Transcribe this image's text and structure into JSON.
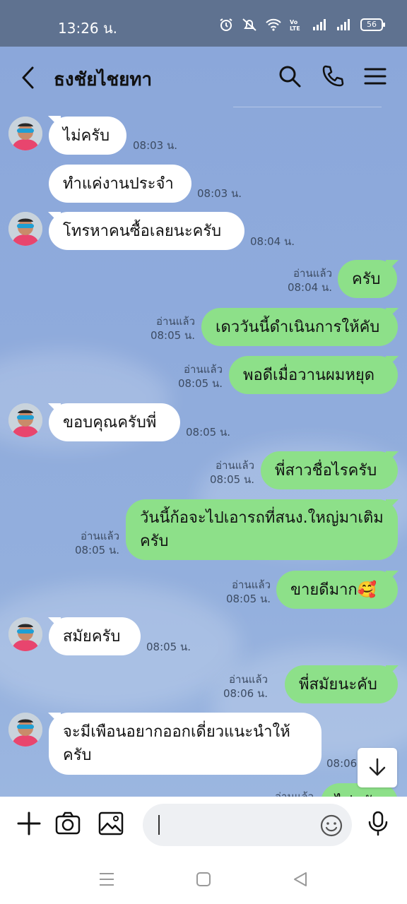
{
  "status_bar": {
    "time": "13:26 น.",
    "battery": "56"
  },
  "header": {
    "contact_name": "ธงชัยไชยทา"
  },
  "messages": [
    {
      "text": "ไม่ครับ",
      "time": "08:03 น."
    },
    {
      "text": "ทำแค่งานประจำ",
      "time": "08:03 น."
    },
    {
      "text": "โทรหาคนซื้อเลยนะครับ",
      "time": "08:04 น."
    },
    {
      "text": "ครับ",
      "read": "อ่านแล้ว",
      "time": "08:04 น."
    },
    {
      "text": "เดววันนี้ดำเนินการให้คับ",
      "read": "อ่านแล้ว",
      "time": "08:05 น."
    },
    {
      "text": "พอดีเมื่อวานผมหยุด",
      "read": "อ่านแล้ว",
      "time": "08:05 น."
    },
    {
      "text": "ขอบคุณครับพี่",
      "time": "08:05 น."
    },
    {
      "text": "พี่สาวชื่อไรครับ",
      "read": "อ่านแล้ว",
      "time": "08:05 น."
    },
    {
      "text": "วันนี้ก้อจะไปเอารถที่สนง.ใหญ่มาเติมครับ",
      "read": "อ่านแล้ว",
      "time": "08:05 น."
    },
    {
      "text": "ขายดีมาก🥰",
      "read": "อ่านแล้ว",
      "time": "08:05 น."
    },
    {
      "text": "สมัยครับ",
      "time": "08:05 น."
    },
    {
      "text": "พี่สมัยนะคับ",
      "read": "อ่านแล้ว",
      "time": "08:06 น."
    },
    {
      "text": "จะมีเพือนอยากออกเดี่ยวแนะนำให้ครับ",
      "time": "08:06"
    },
    {
      "text": "ไม่ครับ",
      "read": "อ่านแล้ว"
    }
  ],
  "icons": {
    "back": "chevron-left-icon",
    "search": "search-icon",
    "call": "phone-icon",
    "menu": "menu-icon",
    "plus": "plus-icon",
    "camera": "camera-icon",
    "gallery": "image-icon",
    "emoji": "emoji-icon",
    "mic": "microphone-icon",
    "scroll_down": "arrow-down-icon"
  },
  "colors": {
    "outgoing_bubble": "#8de089",
    "incoming_bubble": "#ffffff",
    "chat_background": "#8aa9d9",
    "status_bar": "#5f7290"
  }
}
